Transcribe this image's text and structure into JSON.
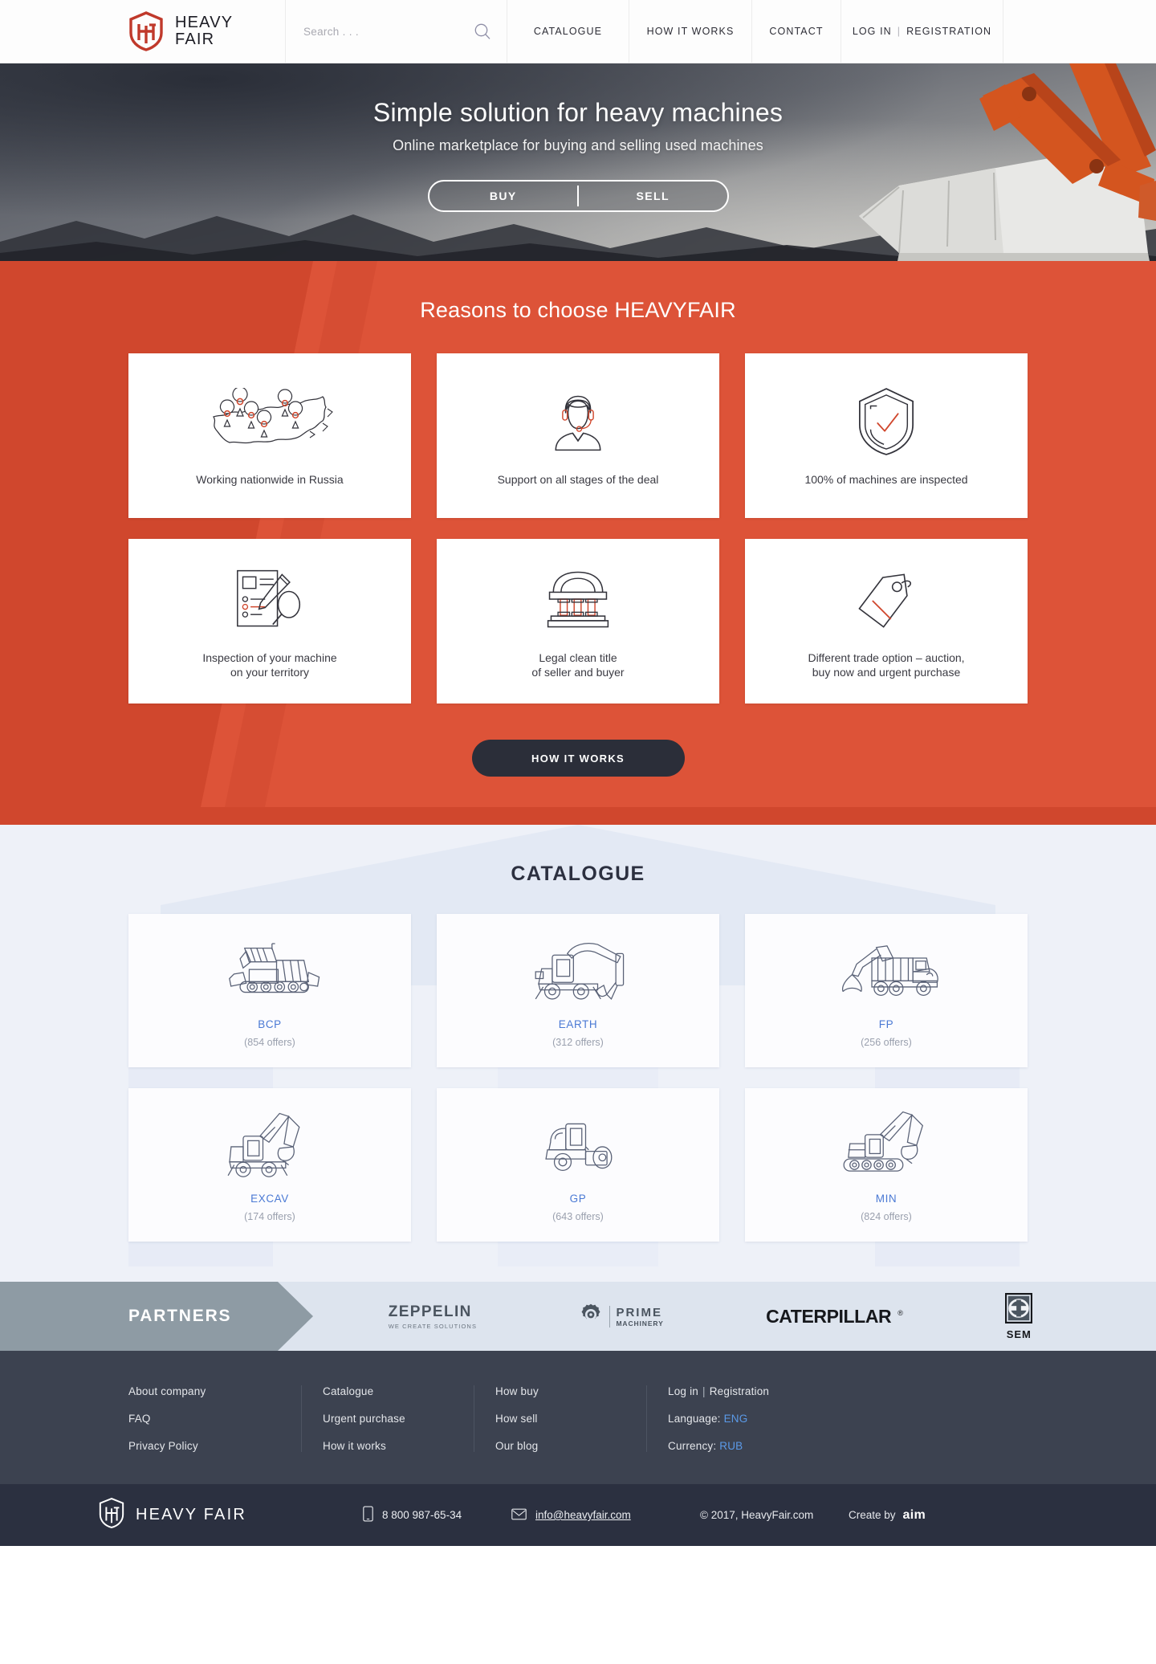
{
  "brand": {
    "name_line1": "HEAVY",
    "name_line2": "FAIR",
    "name_inline": "HEAVY FAIR",
    "logo_icon": "hf-shield-logo"
  },
  "header": {
    "search": {
      "placeholder": "Search . . .",
      "value": "",
      "icon": "search-icon"
    },
    "nav": [
      {
        "label": "CATALOGUE"
      },
      {
        "label": "HOW IT WORKS"
      },
      {
        "label": "CONTACT"
      }
    ],
    "auth": {
      "login": "LOG IN",
      "separator": "|",
      "registration": "REGISTRATION"
    }
  },
  "hero": {
    "title": "Simple solution for heavy machines",
    "subtitle": "Online marketplace for buying and selling used machines",
    "toggle": {
      "buy": "BUY",
      "sell": "SELL"
    },
    "image": "excavator-photo"
  },
  "reasons": {
    "title": "Reasons to choose HEAVYFAIR",
    "accent_color": "#d0472d",
    "cards": [
      {
        "icon": "russia-map-pins-icon",
        "label": "Working nationwide in Russia"
      },
      {
        "icon": "support-agent-headset-icon",
        "label": "Support on all stages of the deal"
      },
      {
        "icon": "shield-check-icon",
        "label": "100% of machines are inspected"
      },
      {
        "icon": "checklist-pencil-magnifier-icon",
        "label": "Inspection of your machine\non your territory"
      },
      {
        "icon": "courthouse-columns-icon",
        "label": "Legal clean title\nof seller and buyer"
      },
      {
        "icon": "price-tag-icon",
        "label": "Different trade option – auction,\nbuy now and urgent purchase"
      }
    ],
    "cta_label": "HOW IT WORKS"
  },
  "catalogue": {
    "title": "CATALOGUE",
    "link_color": "#4a79d4",
    "cards": [
      {
        "icon": "bulldozer-crawler-icon",
        "name": "BCP",
        "offers": "(854 offers)"
      },
      {
        "icon": "wheeled-excavator-icon",
        "name": "EARTH",
        "offers": "(312 offers)"
      },
      {
        "icon": "log-loader-truck-icon",
        "name": "FP",
        "offers": "(256 offers)"
      },
      {
        "icon": "excavator-arm-icon",
        "name": "EXCAV",
        "offers": "(174 offers)"
      },
      {
        "icon": "road-roller-icon",
        "name": "GP",
        "offers": "(643 offers)"
      },
      {
        "icon": "crawler-excavator-icon",
        "name": "MIN",
        "offers": "(824 offers)"
      }
    ]
  },
  "partners": {
    "title": "PARTNERS",
    "logos": [
      {
        "icon": "zeppelin-logo",
        "name": "ZEPPELIN",
        "tagline": "WE CREATE SOLUTIONS"
      },
      {
        "icon": "prime-machinery-logo",
        "name": "PRIME",
        "tagline": "MACHINERY"
      },
      {
        "icon": "caterpillar-logo",
        "name": "CATERPILLAR",
        "mark": "®"
      },
      {
        "icon": "sem-logo",
        "name": "SEM"
      }
    ]
  },
  "footer": {
    "columns": [
      {
        "links": [
          {
            "label": "About company"
          },
          {
            "label": "FAQ"
          },
          {
            "label": "Privacy Policy"
          }
        ]
      },
      {
        "links": [
          {
            "label": "Catalogue"
          },
          {
            "label": "Urgent purchase"
          },
          {
            "label": "How it works"
          }
        ]
      },
      {
        "links": [
          {
            "label": "How buy"
          },
          {
            "label": "How sell"
          },
          {
            "label": "Our blog"
          }
        ]
      }
    ],
    "account": {
      "login": "Log in",
      "separator": "|",
      "registration": "Registration",
      "language_label": "Language:",
      "language_value": "ENG",
      "currency_label": "Currency:",
      "currency_value": "RUB"
    }
  },
  "bottombar": {
    "phone": "8 800 987-65-34",
    "phone_icon": "phone-icon",
    "email": "info@heavyfair.com",
    "email_icon": "mail-icon",
    "copyright": "© 2017, HeavyFair.com",
    "create_by_label": "Create by",
    "create_by_name": "aim"
  }
}
